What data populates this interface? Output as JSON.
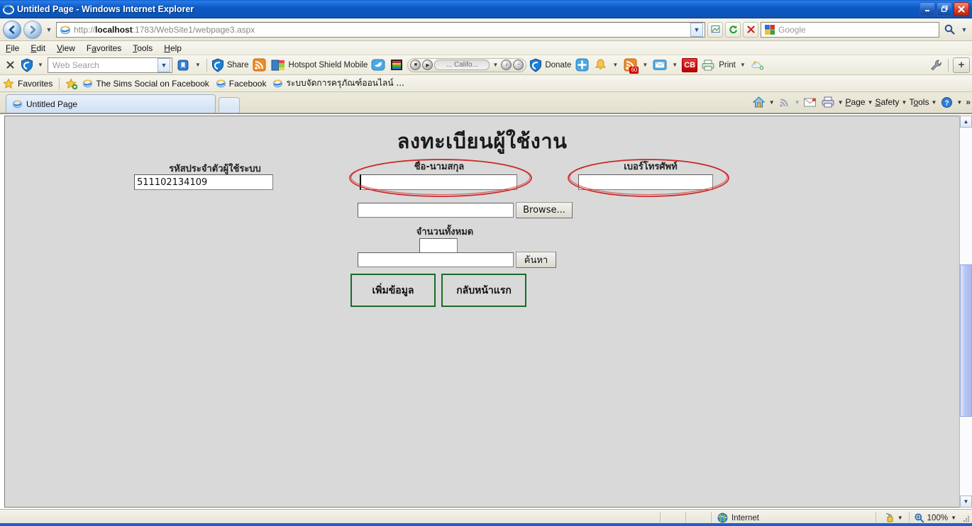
{
  "window": {
    "title": "Untitled Page - Windows Internet Explorer",
    "minimize_label": "Minimize",
    "restore_label": "Restore",
    "close_label": "Close"
  },
  "nav": {
    "back_label": "Back",
    "forward_label": "Forward",
    "recent_pages_label": "Recent Pages",
    "url_prefix": "http://",
    "url_host": "localhost",
    "url_rest": ":1783/WebSite1/webpage3.aspx",
    "url_full": "http://localhost:1783/WebSite1/webpage3.aspx",
    "compat_label": "Compatibility View",
    "refresh_label": "Refresh",
    "stop_label": "Stop",
    "search_provider": "Google",
    "search_value": "",
    "search_go_label": "Search"
  },
  "menu": {
    "items": [
      {
        "label": "File",
        "accel": "F"
      },
      {
        "label": "Edit",
        "accel": "E"
      },
      {
        "label": "View",
        "accel": "V"
      },
      {
        "label": "Favorites",
        "accel": "a"
      },
      {
        "label": "Tools",
        "accel": "T"
      },
      {
        "label": "Help",
        "accel": "H"
      }
    ]
  },
  "addonbar": {
    "close_label": "X",
    "web_search_placeholder": "Web Search",
    "web_search_value": "",
    "share_label": "Share",
    "hotspot_label": "Hotspot Shield Mobile",
    "media_track": "... Califo...",
    "donate_label": "Donate",
    "mail_badge": "60",
    "cb_label": "CB",
    "print_label": "Print",
    "tools_label": "Tools",
    "add_label": "+"
  },
  "favbar": {
    "favorites_label": "Favorites",
    "items": [
      {
        "label": "The Sims Social on Facebook"
      },
      {
        "label": "Facebook"
      },
      {
        "label": "ระบบจัดการครุภัณฑ์ออนไลน์ ..."
      }
    ]
  },
  "tabs": {
    "items": [
      {
        "label": "Untitled Page",
        "active": true
      }
    ],
    "new_tab_label": "New Tab"
  },
  "commandbar": {
    "home_label": "Home",
    "feeds_label": "Feeds",
    "mail_label": "Read Mail",
    "print_label": "Print",
    "page_label": "Page",
    "page_accel": "P",
    "safety_label": "Safety",
    "safety_accel": "S",
    "tools_label": "Tools",
    "tools_accel": "o",
    "help_label": "Help",
    "overflow_label": "»"
  },
  "page": {
    "heading": "ลงทะเบียนผู้ใช้งาน",
    "fields": {
      "user_id_label": "รหัสประจำตัวผู้ใช้ระบบ",
      "user_id_value": "511102134109",
      "fullname_label": "ชื่อ-นามสกุล",
      "fullname_value": "",
      "phone_label": "เบอร์โทรศัพท์",
      "phone_value": "",
      "file_value": "",
      "browse_label": "Browse...",
      "total_label": "จำนวนทั้งหมด",
      "total_value": "",
      "search_value": "",
      "search_label": "ค้นหา"
    },
    "buttons": {
      "add_label": "เพิ่มข้อมูล",
      "home_label": "กลับหน้าแรก"
    },
    "annotations": {
      "ellipse_color": "#cc2b2b",
      "count": 2
    },
    "button_border_color": "#1a6b2a"
  },
  "statusbar": {
    "zone_label": "Internet",
    "protected_label": "Protected Mode",
    "zoom_label": "100%"
  }
}
